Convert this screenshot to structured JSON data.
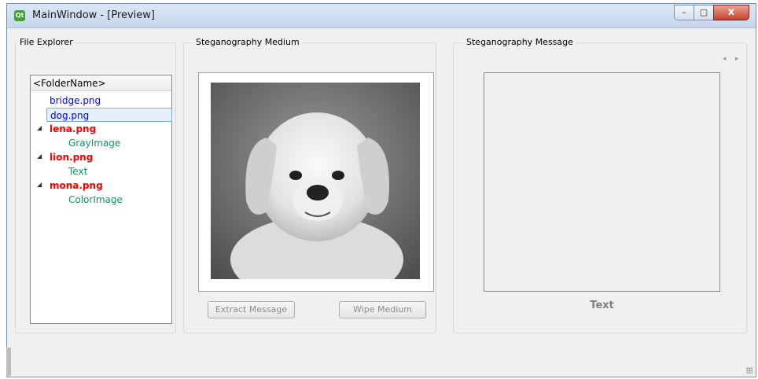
{
  "window": {
    "title": "MainWindow - [Preview]",
    "app_icon_text": "Qt",
    "controls": {
      "minimize": "–",
      "maximize": "▢",
      "close": "x"
    }
  },
  "file_explorer": {
    "group_title": "File Explorer",
    "header": "<FolderName>",
    "items": [
      {
        "label": "bridge.png",
        "color": "#0000ff"
      },
      {
        "label": "dog.png",
        "color": "#0000ff",
        "selected": true
      },
      {
        "label": "lena.png",
        "color": "#ff0000",
        "expanded": true,
        "child": "GrayImage"
      },
      {
        "label": "lion.png",
        "color": "#ff0000",
        "expanded": true,
        "child": "Text"
      },
      {
        "label": "mona.png",
        "color": "#ff0000",
        "expanded": true,
        "child": "ColorImage"
      }
    ]
  },
  "medium": {
    "group_title": "Steganography Medium",
    "image_subject": "white puppy grayscale photo",
    "extract_button": "Extract Message",
    "wipe_button": "Wipe Medium"
  },
  "message": {
    "group_title": "Steganography Message",
    "label": "Text",
    "nav_left": "◂",
    "nav_right": "▸"
  }
}
